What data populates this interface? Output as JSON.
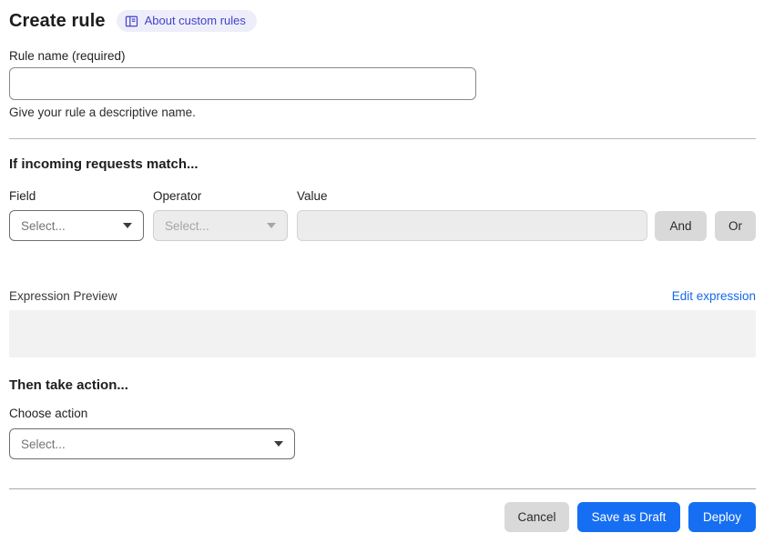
{
  "header": {
    "title": "Create rule",
    "about_badge": {
      "label": "About custom rules",
      "icon": "book-icon"
    }
  },
  "rule_name": {
    "label": "Rule name (required)",
    "value": "",
    "helper": "Give your rule a descriptive name."
  },
  "match_section": {
    "heading": "If incoming requests match...",
    "field": {
      "label": "Field",
      "selected": "Select..."
    },
    "operator": {
      "label": "Operator",
      "selected": "Select...",
      "disabled": true
    },
    "value": {
      "label": "Value",
      "value": "",
      "disabled": true
    },
    "and_button": "And",
    "or_button": "Or",
    "expression_preview": {
      "label": "Expression Preview",
      "edit_link": "Edit expression",
      "content": ""
    }
  },
  "action_section": {
    "heading": "Then take action...",
    "choose_label": "Choose action",
    "selected": "Select..."
  },
  "footer": {
    "cancel": "Cancel",
    "save_draft": "Save as Draft",
    "deploy": "Deploy"
  },
  "colors": {
    "primary_blue": "#166ff2",
    "link_blue": "#1569e8",
    "badge_bg": "#eeeefb",
    "badge_text": "#4242ca",
    "disabled_bg": "#ececec",
    "neutral_button_bg": "#d9d9d9",
    "preview_bg": "#f2f2f2"
  }
}
